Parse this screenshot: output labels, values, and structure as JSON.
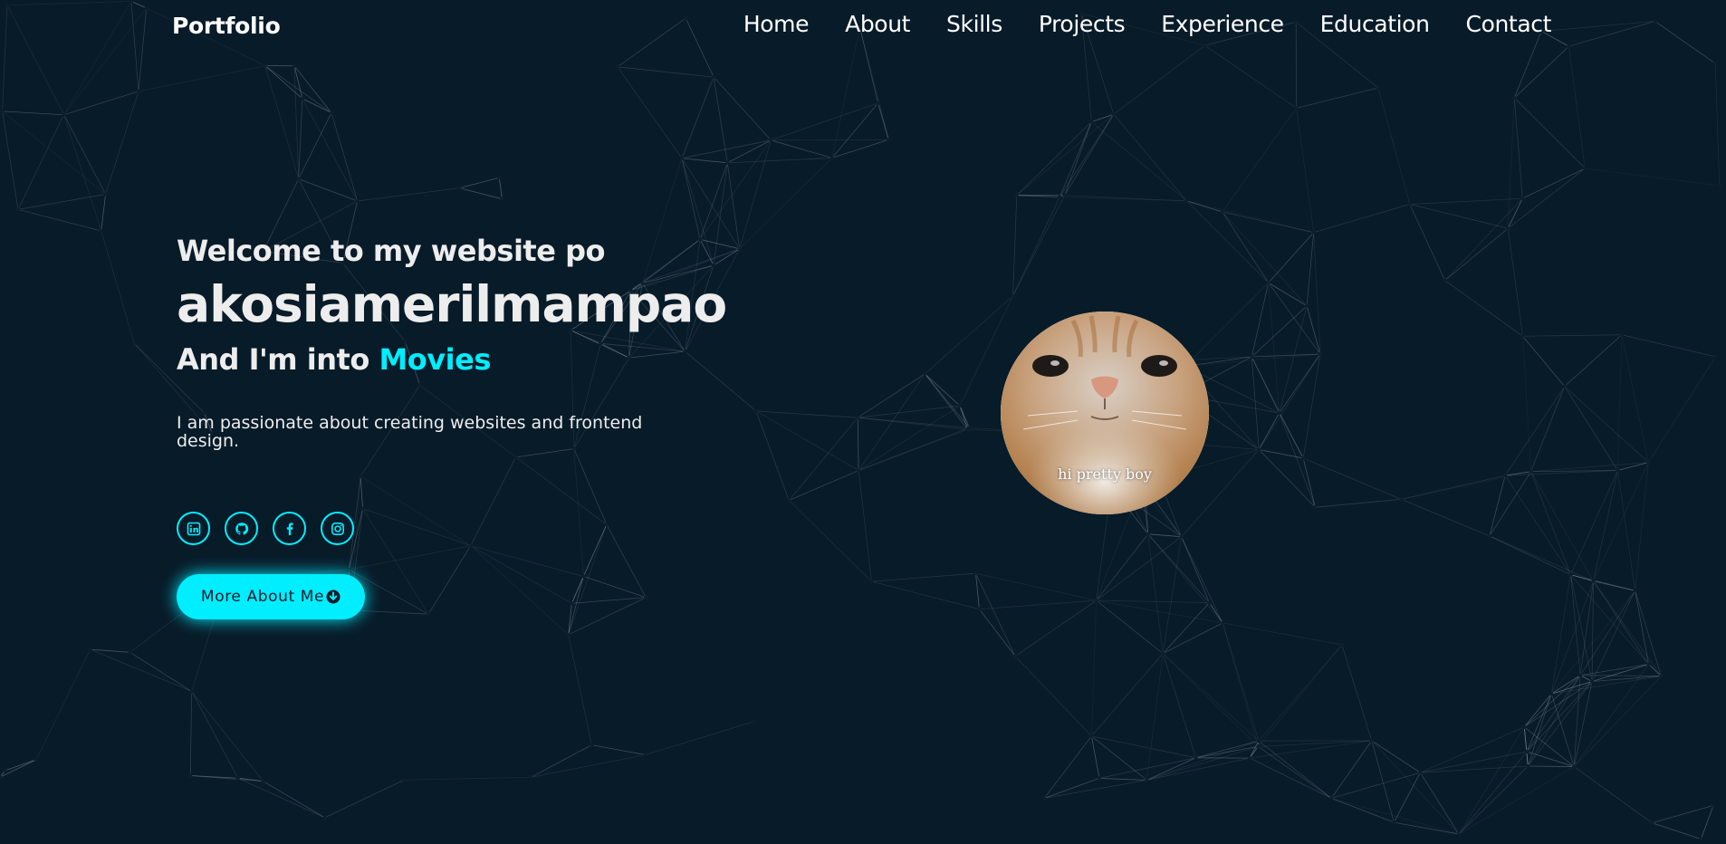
{
  "header": {
    "logo": "Portfolio",
    "nav": [
      "Home",
      "About",
      "Skills",
      "Projects",
      "Experience",
      "Education",
      "Contact"
    ]
  },
  "hero": {
    "welcome": "Welcome to my website po",
    "name": "akosiamerilmampao",
    "into_prefix": "And I'm into",
    "into_word": "Movies",
    "bio": "I am passionate about creating websites and frontend design.",
    "socials": [
      {
        "icon": "linkedin-icon"
      },
      {
        "icon": "github-icon"
      },
      {
        "icon": "facebook-icon"
      },
      {
        "icon": "instagram-icon"
      }
    ],
    "button_label": "More About Me",
    "button_icon": "arrow-down-circle-icon"
  },
  "profile": {
    "caption": "hi pretty boy"
  },
  "colors": {
    "background": "#081b29",
    "accent": "#00eeff",
    "text": "#ededed"
  }
}
